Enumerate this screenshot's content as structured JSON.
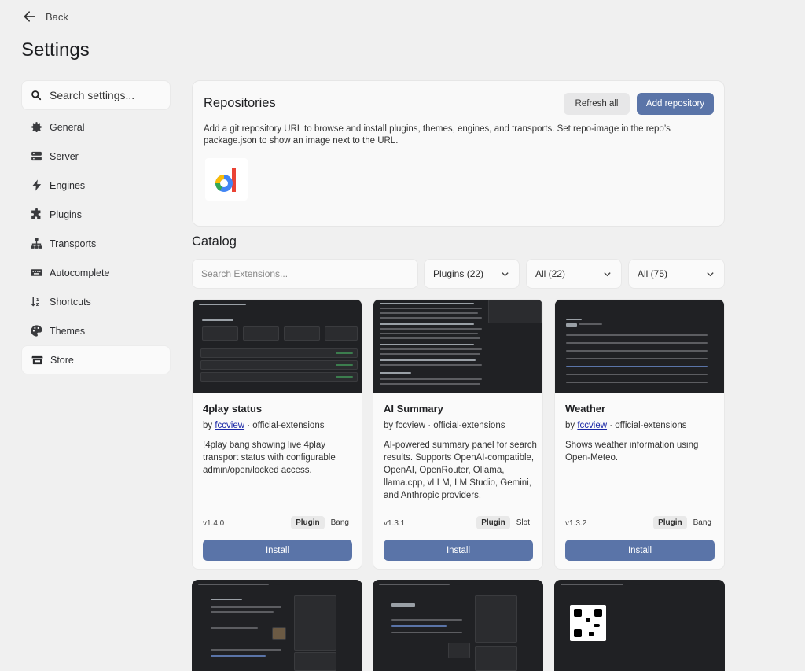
{
  "back": {
    "label": "Back"
  },
  "page_title": "Settings",
  "sidebar": {
    "search_label": "Search settings...",
    "items": [
      {
        "label": "General",
        "icon": "gear-icon"
      },
      {
        "label": "Server",
        "icon": "server-icon"
      },
      {
        "label": "Engines",
        "icon": "bolt-icon"
      },
      {
        "label": "Plugins",
        "icon": "puzzle-icon"
      },
      {
        "label": "Transports",
        "icon": "network-icon"
      },
      {
        "label": "Autocomplete",
        "icon": "keyboard-icon"
      },
      {
        "label": "Shortcuts",
        "icon": "sort-icon"
      },
      {
        "label": "Themes",
        "icon": "palette-icon"
      },
      {
        "label": "Store",
        "icon": "store-icon",
        "active": true
      }
    ]
  },
  "repositories": {
    "title": "Repositories",
    "refresh_label": "Refresh all",
    "add_label": "Add repository",
    "description": "Add a git repository URL to browse and install plugins, themes, engines, and transports. Set repo-image in the repo’s package.json to show an image next to the URL."
  },
  "catalog": {
    "title": "Catalog",
    "search_placeholder": "Search Extensions...",
    "filters": [
      "Plugins (22)",
      "All (22)",
      "All (75)"
    ],
    "cards": [
      {
        "title": "4play status",
        "author": "fccview",
        "source": " · official-extensions",
        "by": "by ",
        "description": "!4play bang showing live 4play transport status with configurable admin/open/locked access.",
        "version": "v1.4.0",
        "tag_primary": "Plugin",
        "tag_secondary": "Bang",
        "install_label": "Install"
      },
      {
        "title": "AI Summary",
        "author": "fccview",
        "source": " · official-extensions",
        "by": "by ",
        "description": "AI-powered summary panel for search results. Supports OpenAI-compatible, OpenAI, OpenRouter, Ollama, llama.cpp, vLLM, LM Studio, Gemini, and Anthropic providers.",
        "version": "v1.3.1",
        "tag_primary": "Plugin",
        "tag_secondary": "Slot",
        "install_label": "Install"
      },
      {
        "title": "Weather",
        "author": "fccview",
        "source": " · official-extensions",
        "by": "by ",
        "description": "Shows weather information using Open-Meteo.",
        "version": "v1.3.2",
        "tag_primary": "Plugin",
        "tag_secondary": "Bang",
        "install_label": "Install"
      }
    ]
  },
  "colors": {
    "accent": "#5a74a8",
    "background": "#f0f0f0",
    "card": "#fafafa",
    "screenshot_bg": "#202124"
  }
}
